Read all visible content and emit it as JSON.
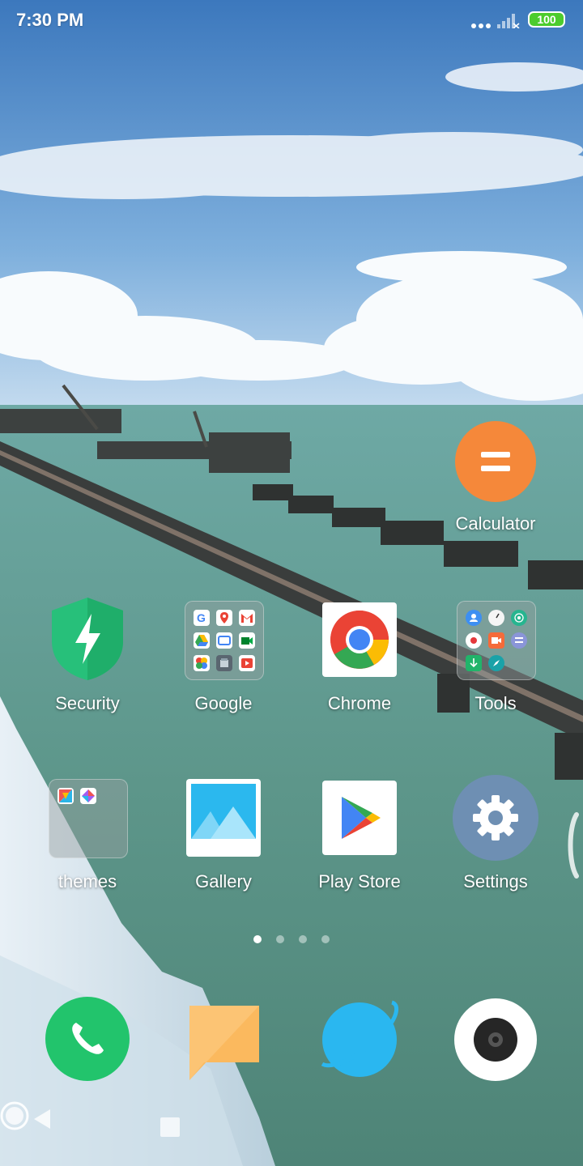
{
  "status_bar": {
    "time": "7:30 PM",
    "battery_level": "100",
    "battery_color": "#4ccc2d",
    "icons": [
      "more-dots-icon",
      "no-signal-icon",
      "battery-icon"
    ]
  },
  "wallpaper": {
    "description_colors": {
      "sky": "#4a86c8",
      "cloud": "#f4f8fc",
      "sea": "#5d968a",
      "pier": "#3b3e3d",
      "ice": "#d8e6ef"
    }
  },
  "home": {
    "calculator": {
      "label": "Calculator",
      "icon": "calculator-icon",
      "color": "#f5883a"
    },
    "row1": [
      {
        "label": "Security",
        "icon": "security-shield-icon",
        "color": "#27c07a"
      },
      {
        "label": "Google",
        "icon": "google-folder-icon",
        "folder_apps": [
          "google-search-icon",
          "google-maps-icon",
          "gmail-icon",
          "google-drive-icon",
          "google-tv-icon",
          "google-meet-icon",
          "google-photos-icon",
          "google-assistant-icon",
          "play-movies-icon"
        ]
      },
      {
        "label": "Chrome",
        "icon": "chrome-icon"
      },
      {
        "label": "Tools",
        "icon": "tools-folder-icon",
        "folder_apps": [
          "contacts-icon",
          "clock-icon",
          "hotspot-icon",
          "recorder-icon",
          "video-icon",
          "notes-icon",
          "downloads-icon",
          "compass-icon"
        ]
      }
    ],
    "row2": [
      {
        "label": "themes",
        "icon": "themes-folder-icon",
        "folder_apps": [
          "themes-app-icon",
          "wallpaper-app-icon"
        ]
      },
      {
        "label": "Gallery",
        "icon": "gallery-icon",
        "color": "#2bb8ee"
      },
      {
        "label": "Play Store",
        "icon": "play-store-icon"
      },
      {
        "label": "Settings",
        "icon": "settings-gear-icon",
        "color": "#6e8fb3"
      }
    ],
    "page_count": 4,
    "active_page": 1
  },
  "dock": [
    {
      "name": "phone",
      "icon": "phone-icon",
      "color": "#22c46c"
    },
    {
      "name": "messages",
      "icon": "messages-icon",
      "color": "#fbb95e"
    },
    {
      "name": "browser",
      "icon": "browser-icon",
      "color": "#2ab7f0"
    },
    {
      "name": "camera",
      "icon": "camera-icon",
      "color": "#ffffff"
    }
  ],
  "nav_bar": {
    "buttons": [
      "recents-square-icon",
      "home-circle-icon",
      "back-triangle-icon"
    ]
  }
}
